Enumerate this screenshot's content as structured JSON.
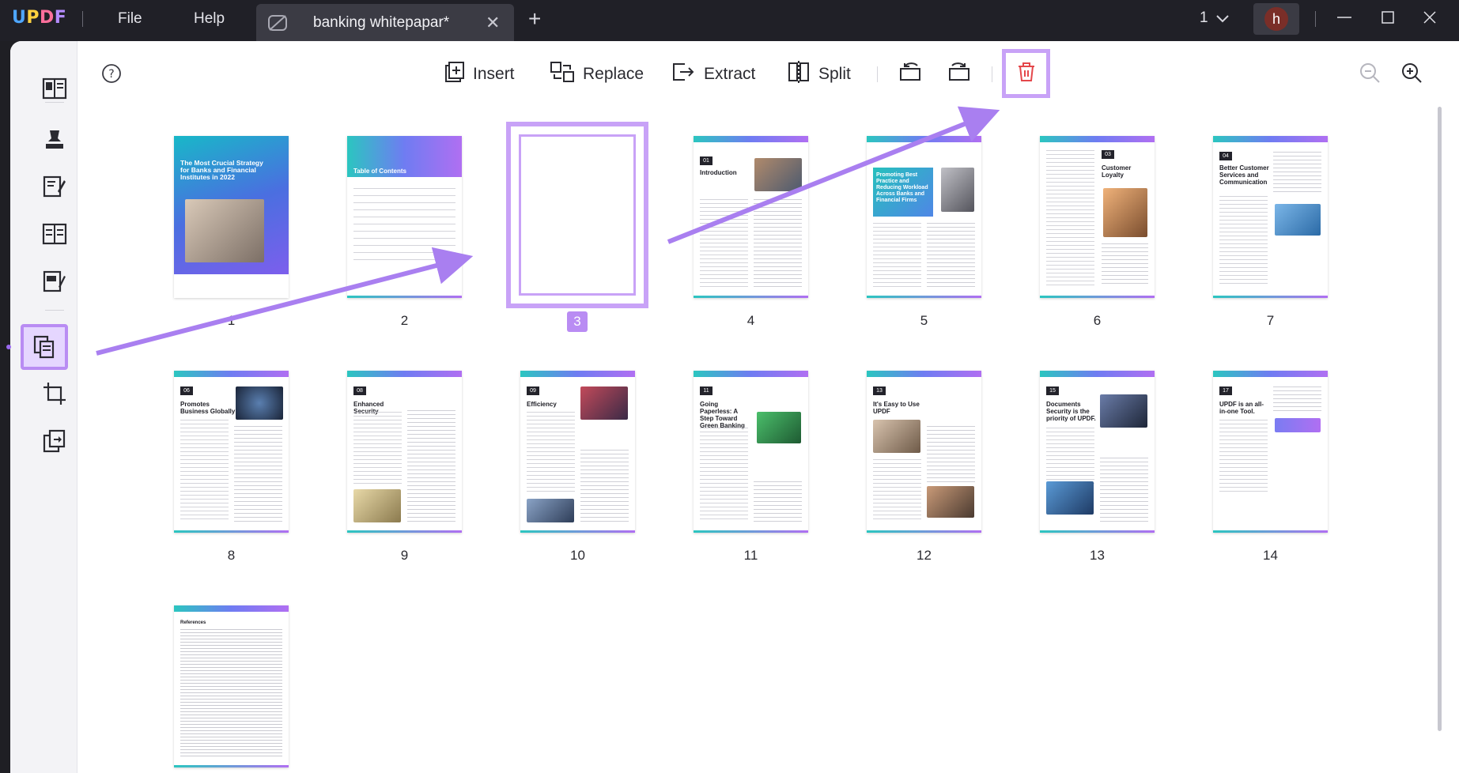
{
  "app": {
    "logo": "UPDF",
    "menu": [
      "File",
      "Help"
    ],
    "tab_title": "banking whitepapar*",
    "page_indicator": "1",
    "avatar_letter": "h"
  },
  "toolbar": {
    "insert": "Insert",
    "replace": "Replace",
    "extract": "Extract",
    "split": "Split"
  },
  "pages": [
    {
      "num": "1",
      "title": "The Most Crucial Strategy for Banks and Financial Institutes in 2022"
    },
    {
      "num": "2",
      "title": "Table of Contents"
    },
    {
      "num": "3",
      "title": ""
    },
    {
      "num": "4",
      "section": "01",
      "title": "Introduction"
    },
    {
      "num": "5",
      "section": "02",
      "title": "Promoting Best Practice and Reducing Workload Across Banks and Financial Firms"
    },
    {
      "num": "6",
      "section": "03",
      "title": "Customer Loyalty"
    },
    {
      "num": "7",
      "section": "04",
      "title": "Better Customer Services and Communication"
    },
    {
      "num": "8",
      "section": "06",
      "title": "Promotes Business Globally"
    },
    {
      "num": "9",
      "section": "08",
      "title": "Enhanced Security"
    },
    {
      "num": "10",
      "section": "09",
      "title": "Efficiency"
    },
    {
      "num": "11",
      "section": "11",
      "title": "Going Paperless: A Step Toward Green Banking"
    },
    {
      "num": "12",
      "section": "13",
      "title": "It's Easy to Use UPDF"
    },
    {
      "num": "13",
      "section": "15",
      "title": "Documents Security is the priority of UPDF."
    },
    {
      "num": "14",
      "section": "17",
      "title": "UPDF is an all-in-one Tool."
    },
    {
      "num": "15",
      "section": "",
      "title": "References"
    }
  ],
  "colors": {
    "accent": "#b98cf3",
    "selection": "#c8a2f7",
    "arrow": "#a97ff0",
    "titlebar": "#202027"
  }
}
